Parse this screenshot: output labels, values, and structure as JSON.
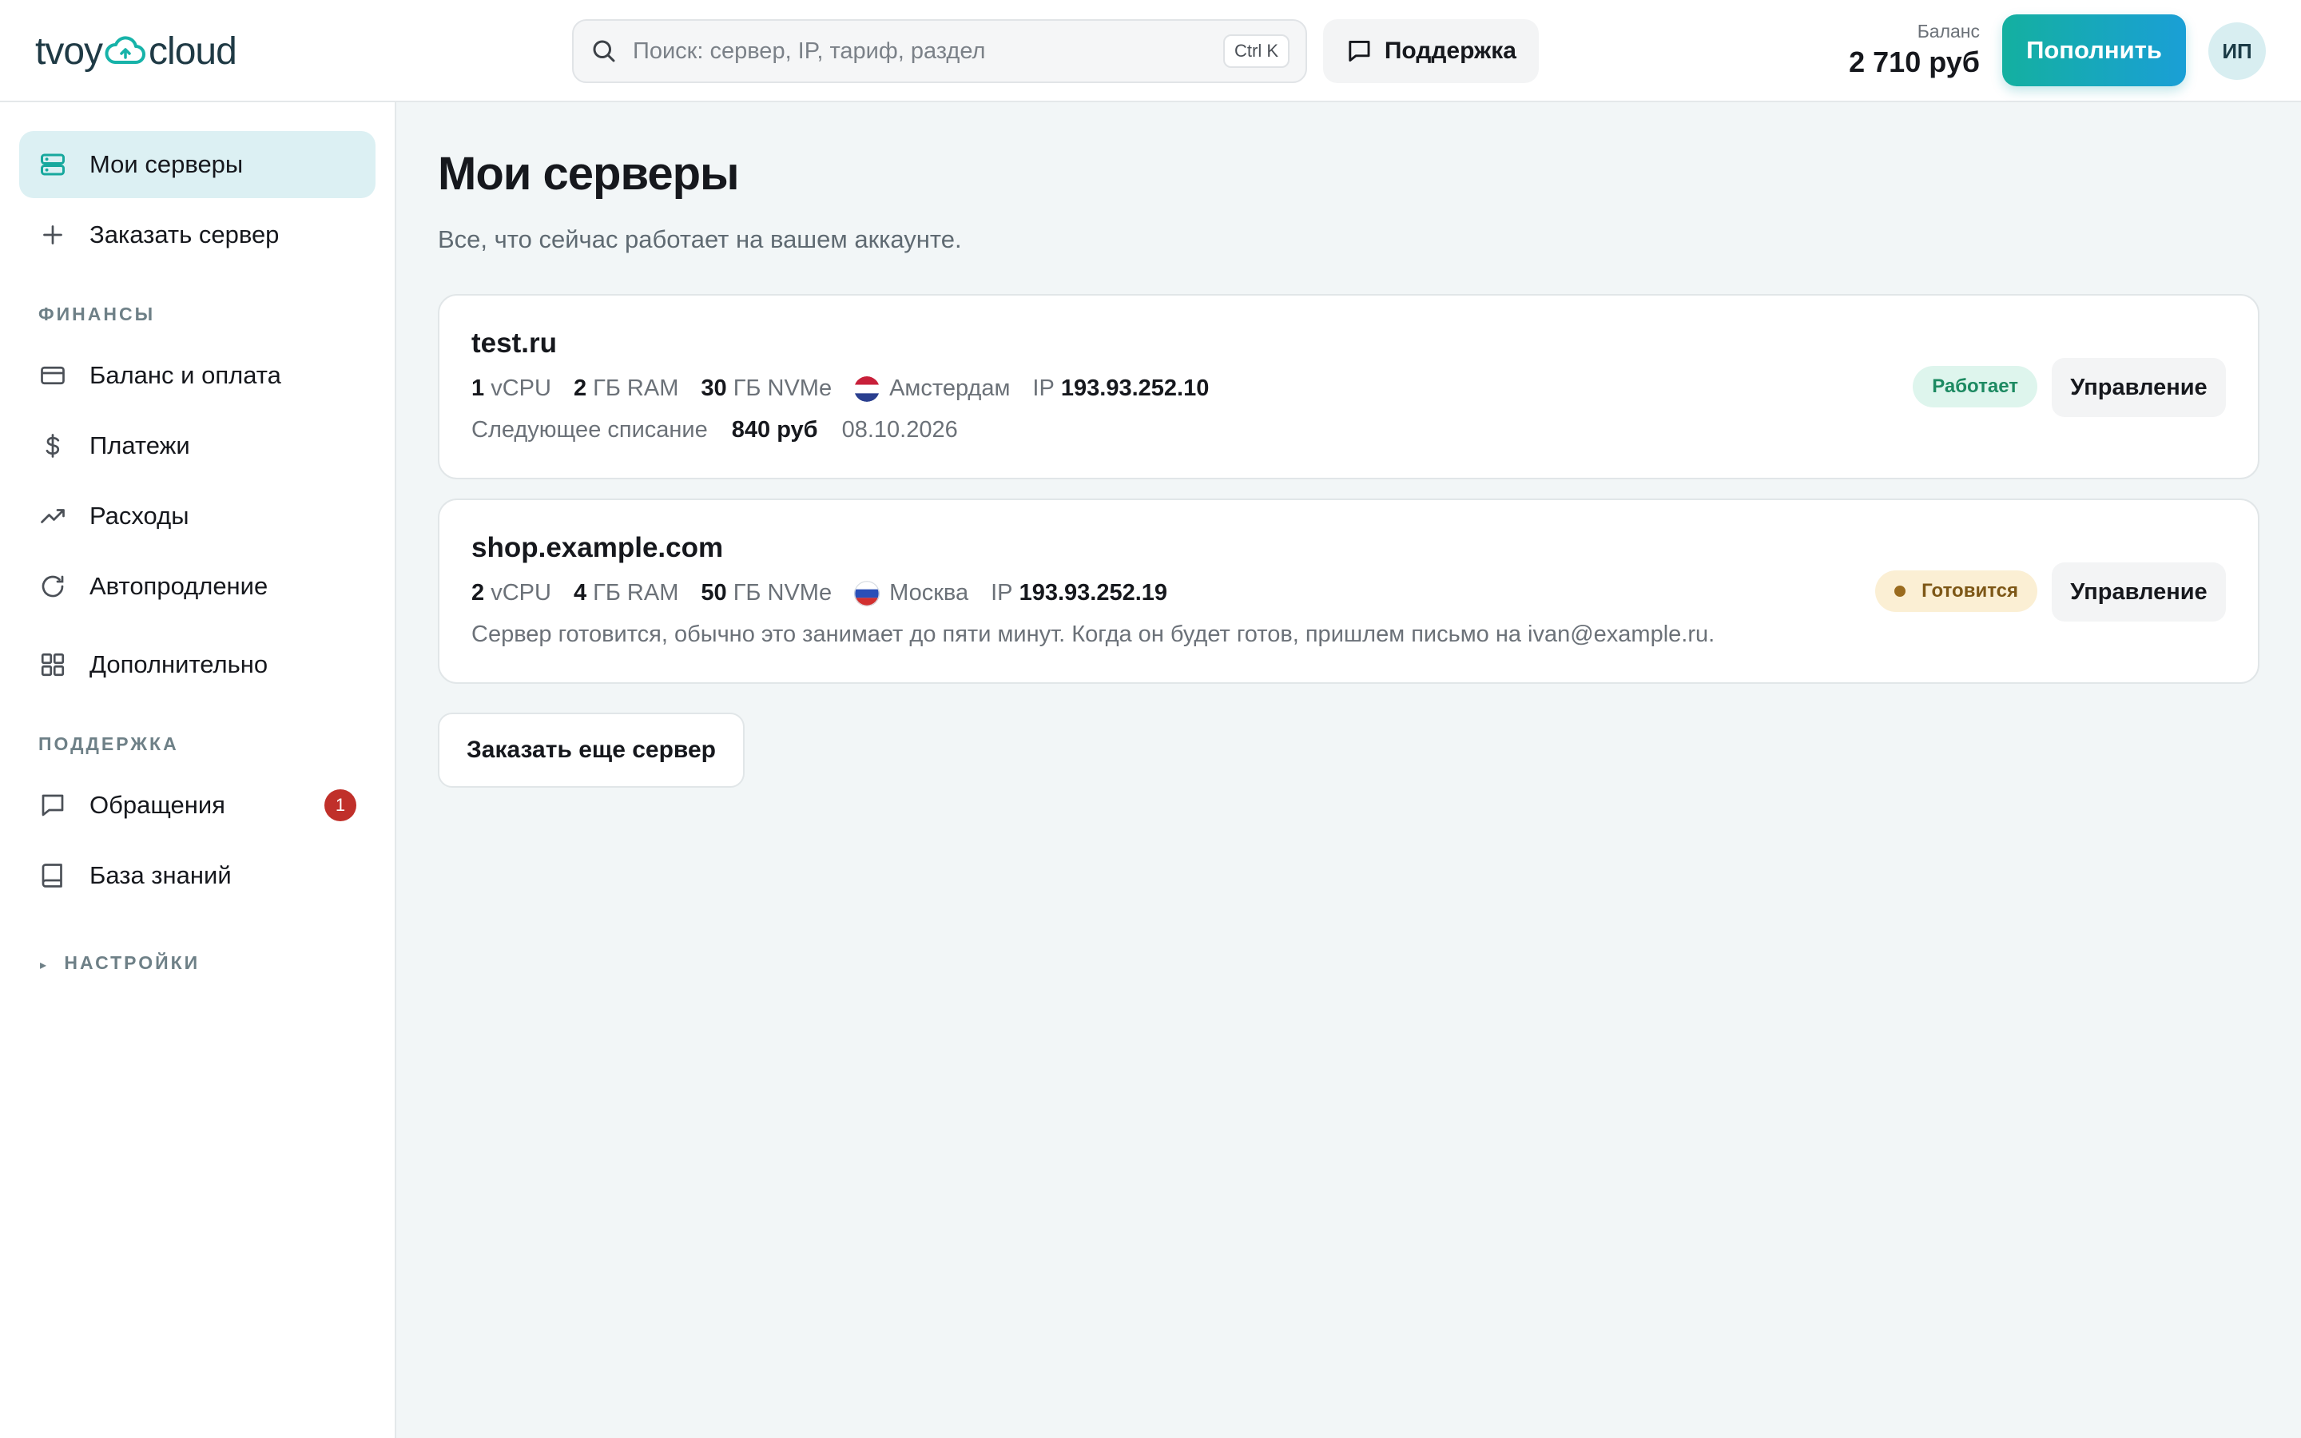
{
  "header": {
    "logo_left": "tvoy",
    "logo_right": "cloud",
    "search_placeholder": "Поиск: сервер, IP, тариф, раздел",
    "search_shortcut": "Ctrl K",
    "support_label": "Поддержка",
    "balance_label": "Баланс",
    "balance_value": "2 710 руб",
    "topup_label": "Пополнить",
    "avatar_initials": "ИП"
  },
  "sidebar": {
    "items": [
      {
        "label": "Мои серверы",
        "icon": "server-icon",
        "active": true
      },
      {
        "label": "Заказать сервер",
        "icon": "plus-icon"
      }
    ],
    "finance_title": "ФИНАНСЫ",
    "finance_items": [
      {
        "label": "Баланс и оплата",
        "icon": "credit-card-icon"
      },
      {
        "label": "Платежи",
        "icon": "dollar-icon"
      },
      {
        "label": "Расходы",
        "icon": "trending-up-icon"
      },
      {
        "label": "Автопродление",
        "icon": "refresh-icon"
      },
      {
        "label": "Дополнительно",
        "icon": "grid-icon"
      }
    ],
    "support_title": "ПОДДЕРЖКА",
    "support_items": [
      {
        "label": "Обращения",
        "icon": "message-icon",
        "badge": "1"
      },
      {
        "label": "База знаний",
        "icon": "book-icon"
      }
    ],
    "settings_title": "НАСТРОЙКИ",
    "settings_caret": "▸"
  },
  "main": {
    "title": "Мои серверы",
    "subtitle": "Все, что сейчас работает на вашем аккаунте.",
    "servers": [
      {
        "name": "test.ru",
        "cpu_num": "1",
        "cpu_unit": "vCPU",
        "ram_num": "2",
        "ram_unit": "ГБ RAM",
        "disk_num": "30",
        "disk_unit": "ГБ NVMe",
        "location": "Амстердам",
        "flag": "netherlands-flag-icon",
        "ip_label": "IP",
        "ip": "193.93.252.10",
        "charge_label": "Следующее списание",
        "charge_amount": "840 руб",
        "charge_date": "08.10.2026",
        "status": "Работает",
        "manage_label": "Управление"
      },
      {
        "name": "shop.example.com",
        "cpu_num": "2",
        "cpu_unit": "vCPU",
        "ram_num": "4",
        "ram_unit": "ГБ RAM",
        "disk_num": "50",
        "disk_unit": "ГБ NVMe",
        "location": "Москва",
        "flag": "russia-flag-icon",
        "ip_label": "IP",
        "ip": "193.93.252.19",
        "note": "Сервер готовится, обычно это занимает до пяти минут. Когда он будет готов, пришлем письмо на ivan@example.ru.",
        "status": "Готовится",
        "manage_label": "Управление"
      }
    ],
    "order_more_label": "Заказать еще сервер"
  },
  "colors": {
    "accent": "#14b0a0",
    "accent_blue": "#1a9fd6",
    "status_ok_bg": "#def5ed",
    "status_ok_text": "#1d8a62",
    "status_wait_bg": "#fbefd4",
    "status_wait_text": "#7d5716",
    "badge": "#c0302a"
  }
}
